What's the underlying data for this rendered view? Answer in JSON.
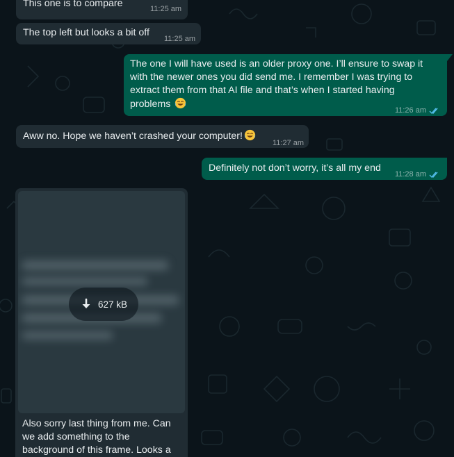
{
  "messages": [
    {
      "direction": "incoming",
      "text": "This one is to compare",
      "time": "11:25 am"
    },
    {
      "direction": "incoming",
      "text": "The top left but looks a bit off",
      "time": "11:25 am"
    },
    {
      "direction": "outgoing",
      "text": "The one I will have used is an older proxy one. I’ll ensure to swap it with the newer ones you did send me. I remember I was trying to extract them from that AI file and that’s when I started having problems",
      "emoji": "face-with-tears-of-joy",
      "time": "11:26 am",
      "status": "read"
    },
    {
      "direction": "incoming",
      "text": "Aww no. Hope we haven’t crashed your computer!",
      "emoji": "face-with-tears-of-joy",
      "time": "11:27 am"
    },
    {
      "direction": "outgoing",
      "text": "Definitely not don’t worry, it’s all my end",
      "time": "11:28 am",
      "status": "read"
    },
    {
      "direction": "incoming",
      "type": "image",
      "download_size": "627 kB",
      "caption": "Also sorry last thing from me. Can we add something to the background of this frame. Looks a"
    }
  ],
  "colors": {
    "background": "#0b141a",
    "incoming_bubble": "#202c33",
    "outgoing_bubble": "#005c4b",
    "read_ticks": "#53bdeb"
  },
  "icons": {
    "read_receipt": "double-check-icon",
    "download": "download-arrow-icon"
  }
}
